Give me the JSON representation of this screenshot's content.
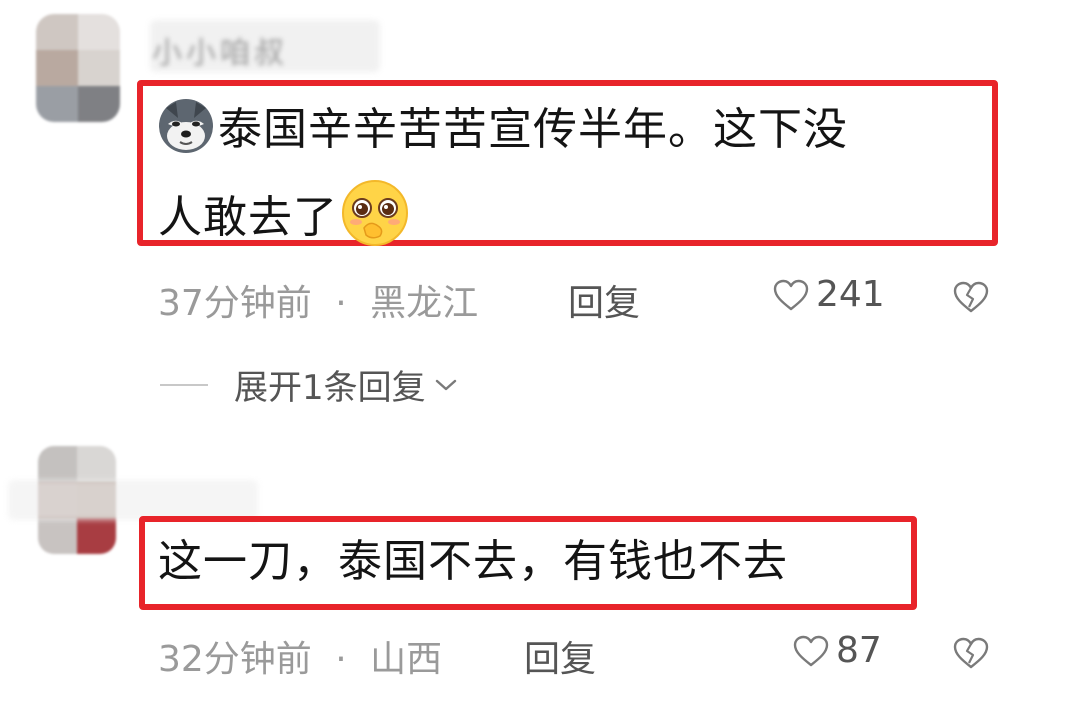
{
  "comments": [
    {
      "username": "小小咱叔",
      "text_line1": "泰国辛辛苦苦宣传半年。这下没",
      "text_line2": "人敢去了",
      "emoji_before": "husky-emoji-icon",
      "emoji_after": "blush-emoji-icon",
      "time": "37分钟前",
      "separator": "·",
      "location": "黑龙江",
      "reply_label": "回复",
      "likes": "241",
      "expand_label": "展开1条回复"
    },
    {
      "text": "这一刀，泰国不去，有钱也不去",
      "time": "32分钟前",
      "separator": "·",
      "location": "山西",
      "reply_label": "回复",
      "likes": "87"
    }
  ],
  "colors": {
    "highlight": "#e8242a",
    "meta_text": "#9a9a9a",
    "action_text": "#555555",
    "body_text": "#141414"
  }
}
